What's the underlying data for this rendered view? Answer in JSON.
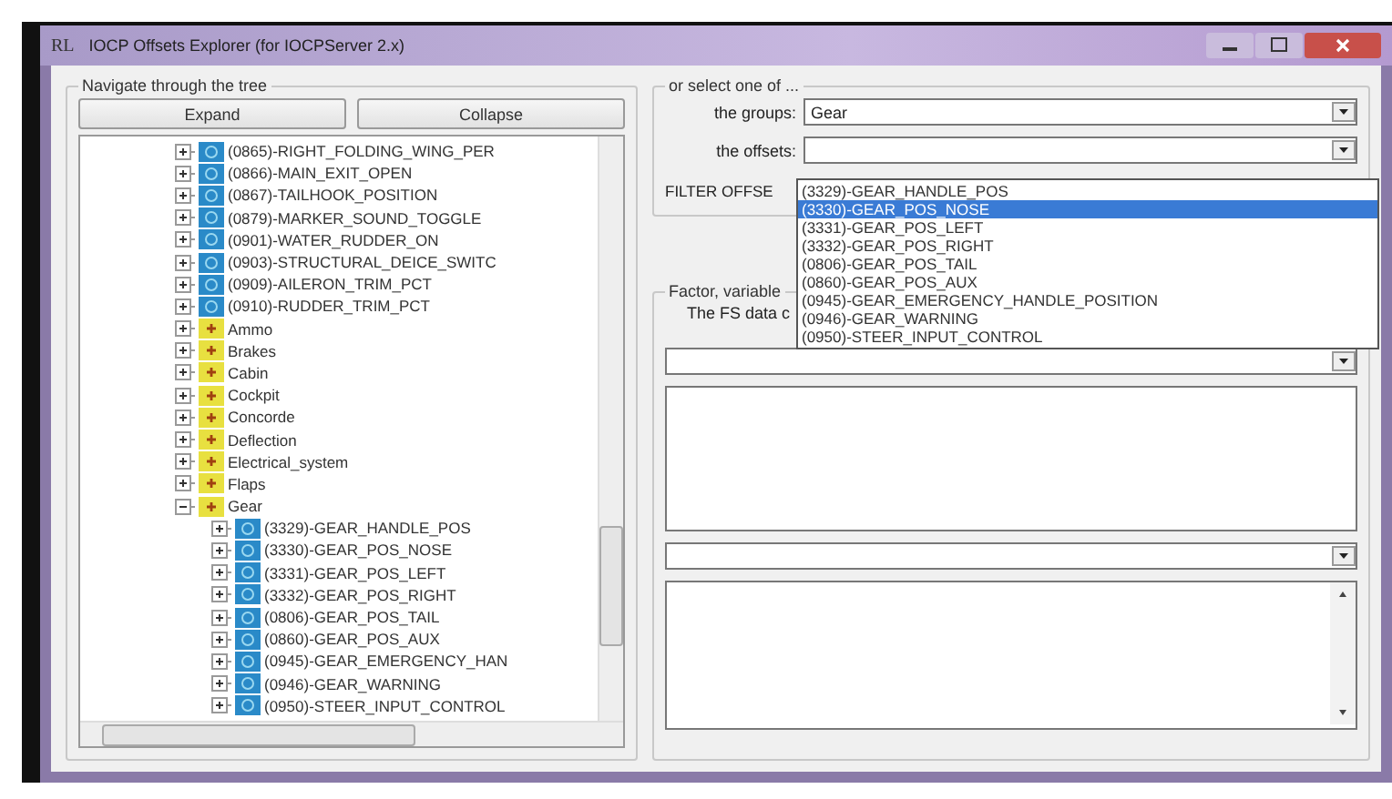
{
  "window": {
    "title": "IOCP Offsets Explorer (for IOCPServer 2.x)",
    "icon": "RL"
  },
  "tree_panel": {
    "legend": "Navigate through the tree",
    "buttons": [
      "Expand",
      "Collapse"
    ],
    "nodes": [
      {
        "kind": "offset",
        "label": "(0865)-RIGHT_FOLDING_WING_PER",
        "expanded": false
      },
      {
        "kind": "offset",
        "label": "(0866)-MAIN_EXIT_OPEN",
        "expanded": false
      },
      {
        "kind": "offset",
        "label": "(0867)-TAILHOOK_POSITION",
        "expanded": false
      },
      {
        "kind": "offset",
        "label": "(0879)-MARKER_SOUND_TOGGLE",
        "expanded": false
      },
      {
        "kind": "offset",
        "label": "(0901)-WATER_RUDDER_ON",
        "expanded": false
      },
      {
        "kind": "offset",
        "label": "(0903)-STRUCTURAL_DEICE_SWITC",
        "expanded": false
      },
      {
        "kind": "offset",
        "label": "(0909)-AILERON_TRIM_PCT",
        "expanded": false
      },
      {
        "kind": "offset",
        "label": "(0910)-RUDDER_TRIM_PCT",
        "expanded": false
      },
      {
        "kind": "group",
        "label": "Ammo",
        "expanded": false
      },
      {
        "kind": "group",
        "label": "Brakes",
        "expanded": false
      },
      {
        "kind": "group",
        "label": "Cabin",
        "expanded": false
      },
      {
        "kind": "group",
        "label": "Cockpit",
        "expanded": false
      },
      {
        "kind": "group",
        "label": "Concorde",
        "expanded": false
      },
      {
        "kind": "group",
        "label": "Deflection",
        "expanded": false
      },
      {
        "kind": "group",
        "label": "Electrical_system",
        "expanded": false
      },
      {
        "kind": "group",
        "label": "Flaps",
        "expanded": false
      },
      {
        "kind": "group",
        "label": "Gear",
        "expanded": true,
        "children": [
          {
            "kind": "offset",
            "label": "(3329)-GEAR_HANDLE_POS",
            "expanded": false
          },
          {
            "kind": "offset",
            "label": "(3330)-GEAR_POS_NOSE",
            "expanded": false
          },
          {
            "kind": "offset",
            "label": "(3331)-GEAR_POS_LEFT",
            "expanded": false
          },
          {
            "kind": "offset",
            "label": "(3332)-GEAR_POS_RIGHT",
            "expanded": false
          },
          {
            "kind": "offset",
            "label": "(0806)-GEAR_POS_TAIL",
            "expanded": false
          },
          {
            "kind": "offset",
            "label": "(0860)-GEAR_POS_AUX",
            "expanded": false
          },
          {
            "kind": "offset",
            "label": "(0945)-GEAR_EMERGENCY_HAN",
            "expanded": false
          },
          {
            "kind": "offset",
            "label": "(0946)-GEAR_WARNING",
            "expanded": false
          },
          {
            "kind": "offset",
            "label": "(0950)-STEER_INPUT_CONTROL",
            "expanded": false
          }
        ]
      }
    ]
  },
  "select_panel": {
    "legend": "or select one of ...",
    "groups_label": "the groups:",
    "groups_value": "Gear",
    "offsets_label": "the offsets:",
    "filter_label": "FILTER OFFSE",
    "offset_options": [
      {
        "label": "(3329)-GEAR_HANDLE_POS",
        "selected": false
      },
      {
        "label": "(3330)-GEAR_POS_NOSE",
        "selected": true
      },
      {
        "label": "(3331)-GEAR_POS_LEFT",
        "selected": false
      },
      {
        "label": "(3332)-GEAR_POS_RIGHT",
        "selected": false
      },
      {
        "label": "(0806)-GEAR_POS_TAIL",
        "selected": false
      },
      {
        "label": "(0860)-GEAR_POS_AUX",
        "selected": false
      },
      {
        "label": "(0945)-GEAR_EMERGENCY_HANDLE_POSITION",
        "selected": false
      },
      {
        "label": "(0946)-GEAR_WARNING",
        "selected": false
      },
      {
        "label": "(0950)-STEER_INPUT_CONTROL",
        "selected": false
      }
    ]
  },
  "factor_panel": {
    "legend": "Factor, variable",
    "data_label": "The FS data c"
  }
}
